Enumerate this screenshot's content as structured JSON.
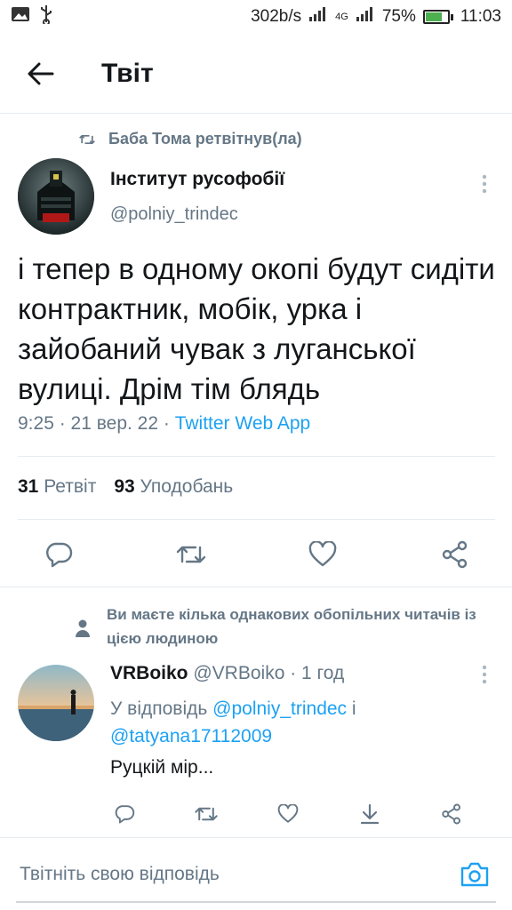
{
  "status_bar": {
    "network_speed": "302b/s",
    "network_type": "4G",
    "battery_percent": "75%",
    "battery_level": 0.75,
    "time": "11:03"
  },
  "header": {
    "title": "Твіт"
  },
  "tweet": {
    "retweeted_by": "Баба Тома ретвітнув(ла)",
    "author_name": "Інститут русофобії",
    "author_handle": "@polniy_trindec",
    "text": "і тепер в одному окопі будут сидіти контрактник, мобік, урка і зайобаний чувак з луганської вулиці. Дрім тім блядь",
    "time": "9:25 · 21 вер. 22 · ",
    "app": "Twitter Web App",
    "retweets_count": "31",
    "retweets_label": "Ретвіт",
    "likes_count": "93",
    "likes_label": "Уподобань"
  },
  "mutual_notice": "Ви маєте кілька однакових обопільних читачів із цією людиною",
  "reply": {
    "author_name": "VRBoiko",
    "author_handle": "@VRBoiko · 1 год",
    "reply_to_prefix": "У відповідь ",
    "mention1": "@polniy_trindec",
    "joiner": " і ",
    "mention2": "@tatyana17112009",
    "text": "Руцкій мір..."
  },
  "compose": {
    "placeholder": "Твітніть свою відповідь"
  },
  "colors": {
    "accent": "#1da1f2",
    "secondary_text": "#657786",
    "divider": "#e6ecf0"
  }
}
